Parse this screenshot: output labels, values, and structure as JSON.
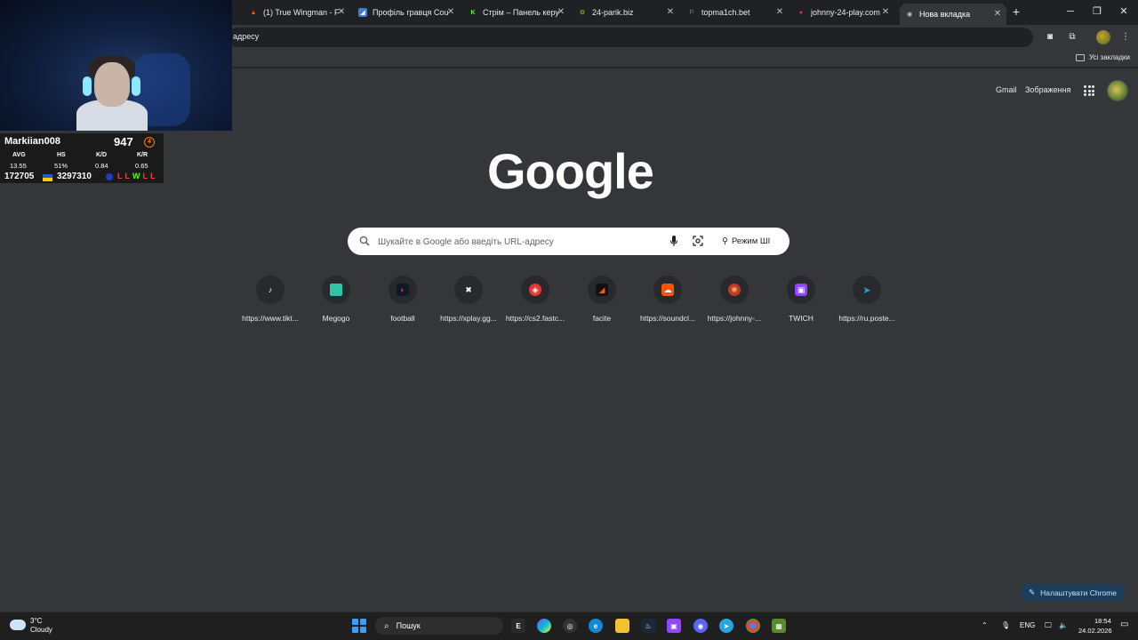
{
  "tabs": [
    {
      "title": "(1) True Wingman - F",
      "favicon_color": "#ff5500",
      "favicon_glyph": "▲"
    },
    {
      "title": "Профіль гравця Cou",
      "favicon_color": "#3d7bd9",
      "favicon_glyph": "◢"
    },
    {
      "title": "Стрім – Панель керу",
      "favicon_color": "#53fc18",
      "favicon_glyph": "K"
    },
    {
      "title": "24-parik.biz",
      "favicon_color": "#9acd32",
      "favicon_glyph": "⚙"
    },
    {
      "title": "topma1ch.bet",
      "favicon_color": "#5f6368",
      "favicon_glyph": "⚐"
    },
    {
      "title": "johnny-24-play.com",
      "favicon_color": "#d63a3a",
      "favicon_glyph": "●"
    },
    {
      "title": "Нова вкладка",
      "favicon_color": "#5f6368",
      "favicon_glyph": "◉"
    }
  ],
  "omnibox": {
    "text": "адресу"
  },
  "bookmarks_bar": {
    "all_bookmarks": "Усі закладки"
  },
  "header": {
    "gmail": "Gmail",
    "images": "Зображення"
  },
  "logo": "Google",
  "search": {
    "placeholder": "Шукайте в Google або введіть URL-адресу",
    "ai_mode": "Режим ШІ"
  },
  "shortcuts": [
    {
      "label": "https://www.tikt...",
      "icon_color": "#000000",
      "glyph": "♪"
    },
    {
      "label": "Megogo",
      "icon_color": "#2ec4a5",
      "glyph": "▬"
    },
    {
      "label": "football",
      "icon_color": "#111827",
      "glyph": "◐"
    },
    {
      "label": "https://xplay.gg...",
      "icon_color": "#000000",
      "glyph": "✖"
    },
    {
      "label": "https://cs2.fastc...",
      "icon_color": "#e53935",
      "glyph": "◈"
    },
    {
      "label": "facite",
      "icon_color": "#111111",
      "glyph": "◢"
    },
    {
      "label": "https://soundcl...",
      "icon_color": "#ff5500",
      "glyph": "☁"
    },
    {
      "label": "https://johnny-...",
      "icon_color": "#c0392b",
      "glyph": "✺"
    },
    {
      "label": "TWICH",
      "icon_color": "#9146ff",
      "glyph": "▣"
    },
    {
      "label": "https://ru.poste...",
      "icon_color": "#1fa3d6",
      "glyph": "➤"
    }
  ],
  "customize_button": "Налаштувати Chrome",
  "stream_overlay": {
    "player_name": "Markiian008",
    "elo": "947",
    "level": "4",
    "headers": [
      "AVG",
      "HS",
      "K/D",
      "K/R"
    ],
    "values": [
      "13.55",
      "51%",
      "0.84",
      "0.65"
    ],
    "stat_a": "172705",
    "stat_b": "3297310",
    "results": [
      "L",
      "L",
      "W",
      "L",
      "L"
    ]
  },
  "taskbar": {
    "weather_temp": "3°C",
    "weather_condition": "Cloudy",
    "search_label": "Пошук",
    "language": "ENG",
    "time": "18:54",
    "date": "24.02.2026"
  },
  "colors": {
    "accent": "#1a73e8",
    "page_bg": "#35363a",
    "win": "#53fc18",
    "loss": "#ff3b30"
  }
}
